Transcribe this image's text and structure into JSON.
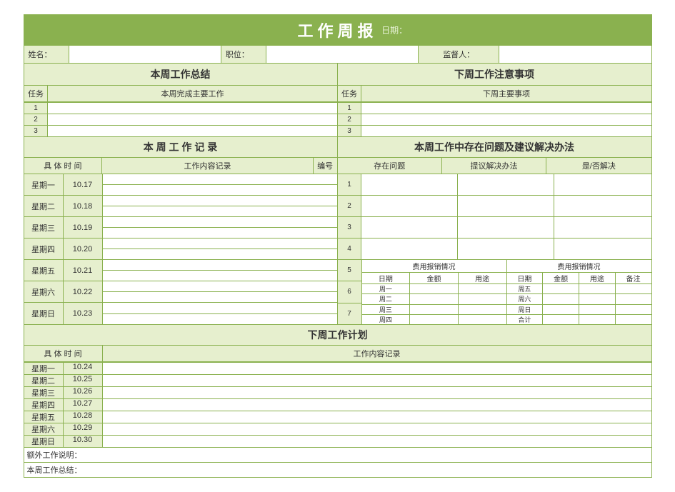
{
  "title": "工作周报",
  "date_label": "日期：",
  "info": {
    "name_label": "姓名：",
    "position_label": "职位：",
    "supervisor_label": "监督人："
  },
  "summary_left": "本周工作总结",
  "summary_right": "下周工作注意事项",
  "task_label": "任务",
  "task_left_head": "本周完成主要工作",
  "task_right_head": "下周主要事项",
  "task_nums": [
    "1",
    "2",
    "3"
  ],
  "mid_left_title": "本 周 工 作 记 录",
  "mid_right_title": "本周工作中存在问题及建议解决办法",
  "time_label": "具 体 时 间",
  "record_label": "工作内容记录",
  "number_label": "编号",
  "prob_cols": [
    "存在问题",
    "提议解决办法",
    "是/否解决"
  ],
  "week_records": [
    {
      "day": "星期一",
      "date": "10.17"
    },
    {
      "day": "星期二",
      "date": "10.18"
    },
    {
      "day": "星期三",
      "date": "10.19"
    },
    {
      "day": "星期四",
      "date": "10.20"
    },
    {
      "day": "星期五",
      "date": "10.21"
    },
    {
      "day": "星期六",
      "date": "10.22"
    },
    {
      "day": "星期日",
      "date": "10.23"
    }
  ],
  "prob_nums": [
    "1",
    "2",
    "3",
    "4"
  ],
  "fee_idx": [
    "5",
    "6",
    "7"
  ],
  "fee_title": "费用报销情况",
  "fee_heads_a": [
    "日期",
    "金额",
    "用途"
  ],
  "fee_heads_b": [
    "日期",
    "金额",
    "用途",
    "备注"
  ],
  "fee_rows_a": [
    "周一",
    "周二",
    "周三",
    "周四"
  ],
  "fee_rows_b": [
    "周五",
    "周六",
    "周日",
    "合计"
  ],
  "plan_title": "下周工作计划",
  "plan_records": [
    {
      "day": "星期一",
      "date": "10.24"
    },
    {
      "day": "星期二",
      "date": "10.25"
    },
    {
      "day": "星期三",
      "date": "10.26"
    },
    {
      "day": "星期四",
      "date": "10.27"
    },
    {
      "day": "星期五",
      "date": "10.28"
    },
    {
      "day": "星期六",
      "date": "10.29"
    },
    {
      "day": "星期日",
      "date": "10.30"
    }
  ],
  "extra_label": "额外工作说明：",
  "summary_label": "本周工作总结："
}
